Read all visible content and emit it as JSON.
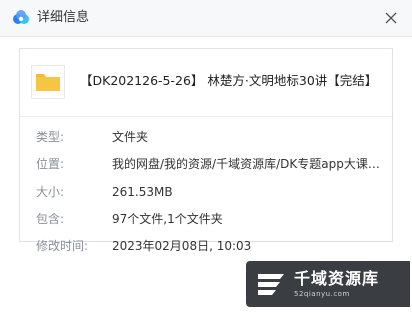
{
  "window": {
    "title": "详细信息",
    "app_icon": "baidu-netdisk-cloud-icon",
    "close_icon": "close-icon"
  },
  "file": {
    "icon": "folder-icon",
    "name": "【DK202126-5-26】 林楚方·文明地标30讲【完结】"
  },
  "details": [
    {
      "label": "类型:",
      "value": "文件夹"
    },
    {
      "label": "位置:",
      "value": "我的网盘/我的资源/千域资源库/DK专题app大课合集"
    },
    {
      "label": "大小:",
      "value": "261.53MB"
    },
    {
      "label": "包含:",
      "value": "97个文件,1个文件夹"
    },
    {
      "label": "修改时间:",
      "value": "2023年02月08日, 10:03"
    }
  ],
  "watermark": {
    "title": "千域资源库",
    "subtitle": "52qianyu.com",
    "icon": "qianyu-logo-icon"
  },
  "colors": {
    "titlebar_bg": "#f7f8fa",
    "folder_yellow": "#f7c544",
    "label_gray": "#8a8f99",
    "watermark_bg": "#3a3d42"
  }
}
